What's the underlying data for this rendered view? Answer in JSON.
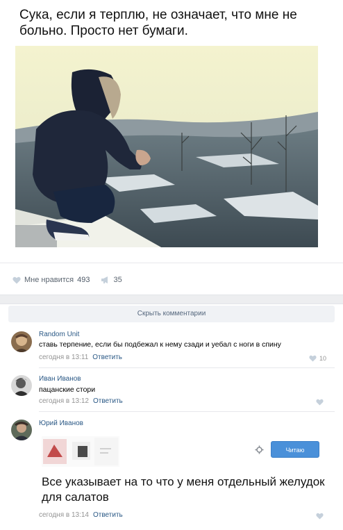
{
  "post": {
    "text": "Сука, если я терплю, не означает, что мне не больно. Просто нет бумаги.",
    "likes_label": "Мне нравится",
    "likes_count": "493",
    "reposts_count": "35"
  },
  "comments_toggle": "Скрыть комментарии",
  "comments": [
    {
      "author": "Random Unit",
      "text": "ставь терпение, если бы подбежал к нему сзади и уебал с ноги в спину",
      "time": "сегодня в 13:11",
      "reply": "Ответить",
      "likes": "10"
    },
    {
      "author": "Иван Иванов",
      "text": "пацанские стори",
      "time": "сегодня в 13:12",
      "reply": "Ответить",
      "likes": ""
    },
    {
      "author": "Юрий Иванов",
      "text": "Все указывает на то что у меня отдельный желудок для салатов",
      "time": "сегодня в 13:14",
      "reply": "Ответить",
      "likes": "",
      "follow_button": "Читаю"
    }
  ],
  "colors": {
    "link": "#2a5885",
    "meta": "#939393",
    "button": "#4a90d9"
  }
}
